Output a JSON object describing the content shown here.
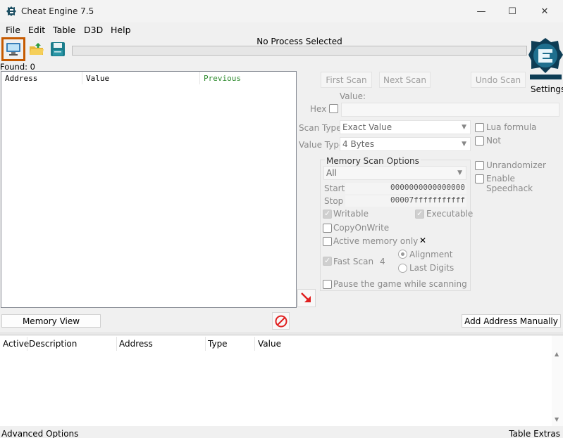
{
  "window": {
    "title": "Cheat Engine 7.5",
    "minimize_glyph": "—",
    "maximize_glyph": "☐",
    "close_glyph": "✕"
  },
  "menu": [
    "File",
    "Edit",
    "Table",
    "D3D",
    "Help"
  ],
  "toolbar": {
    "process_label": "No Process Selected",
    "icons": [
      "monitor-icon",
      "open-folder-icon",
      "save-icon"
    ],
    "accent_color": "#c65a00"
  },
  "logo": {
    "settings_label": "Settings"
  },
  "results": {
    "found_label": "Found: 0",
    "columns": [
      "Address",
      "Value",
      "Previous"
    ],
    "previous_color": "#2e8b2e"
  },
  "scan": {
    "first_scan": "First Scan",
    "next_scan": "Next Scan",
    "undo_scan": "Undo Scan",
    "value_label": "Value:",
    "hex_label": "Hex",
    "scan_type_label": "Scan Type",
    "scan_type_value": "Exact Value",
    "value_type_label": "Value Type",
    "value_type_value": "4 Bytes",
    "lua_formula": "Lua formula",
    "not_label": "Not",
    "unrandomizer": "Unrandomizer",
    "enable_speedhack": "Enable Speedhack"
  },
  "memory_options": {
    "title": "Memory Scan Options",
    "region_value": "All",
    "start_label": "Start",
    "start_value": "0000000000000000",
    "stop_label": "Stop",
    "stop_value": "00007fffffffffff",
    "writable": "Writable",
    "executable": "Executable",
    "copy_on_write": "CopyOnWrite",
    "active_memory_only": "Active memory only",
    "fast_scan": "Fast Scan",
    "fast_scan_value": "4",
    "alignment": "Alignment",
    "last_digits": "Last Digits",
    "pause_game": "Pause the game while scanning"
  },
  "bottom": {
    "memory_view": "Memory View",
    "add_address_manually": "Add Address Manually",
    "columns": [
      "Active",
      "Description",
      "Address",
      "Type",
      "Value"
    ],
    "advanced_options": "Advanced Options",
    "table_extras": "Table Extras"
  }
}
